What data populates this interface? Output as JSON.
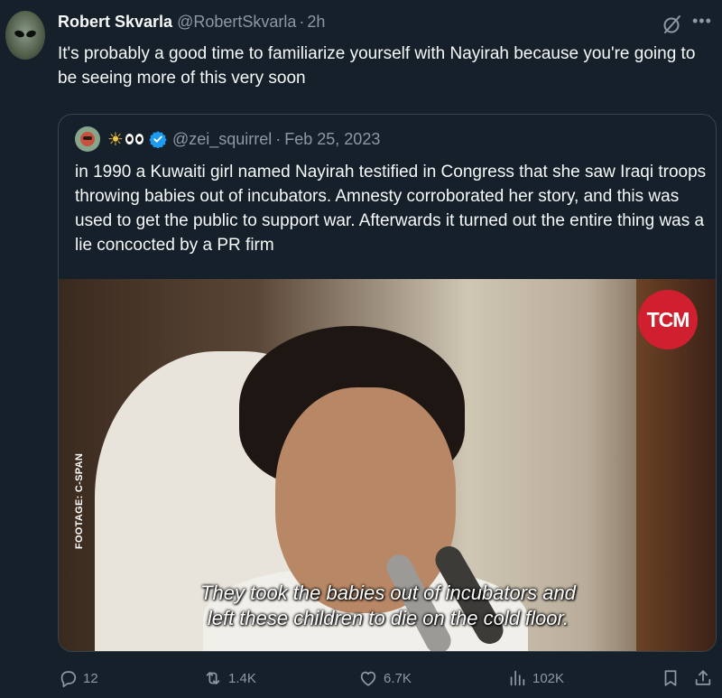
{
  "tweet": {
    "author_name": "Robert Skvarla",
    "author_handle": "@RobertSkvarla",
    "separator": "·",
    "time": "2h",
    "text": "It's probably a good time to familiarize yourself with Nayirah because you're going to be seeing more of this very soon"
  },
  "quote": {
    "author_name_emoji": "☀️👀",
    "handle": "@zei_squirrel",
    "separator": "·",
    "date": "Feb 25, 2023",
    "text": "in 1990 a Kuwaiti girl named Nayirah testified in Congress that she saw Iraqi troops throwing babies out of incubators. Amnesty corroborated her story, and this was used to get the public to support war. Afterwards it turned out the entire thing was a lie concocted by a PR firm",
    "video": {
      "watermark": "TCM",
      "footage_label": "FOOTAGE: C-SPAN",
      "caption_line1": "They took the babies out of incubators and",
      "caption_line2": "left these children to die on the cold floor."
    }
  },
  "actions": {
    "replies": "12",
    "reposts": "1.4K",
    "likes": "6.7K",
    "views": "102K"
  },
  "icons": {
    "grok": "grok-icon",
    "more": "more-icon",
    "verified": "verified-badge-icon",
    "reply": "reply-icon",
    "repost": "repost-icon",
    "like": "heart-icon",
    "views": "views-icon",
    "bookmark": "bookmark-icon",
    "share": "share-icon"
  },
  "colors": {
    "background": "#15202b",
    "text": "#f7f9f9",
    "muted": "#8b98a5",
    "border": "#38444d",
    "verified": "#1d9bf0",
    "tcm_red": "#d0202f"
  }
}
